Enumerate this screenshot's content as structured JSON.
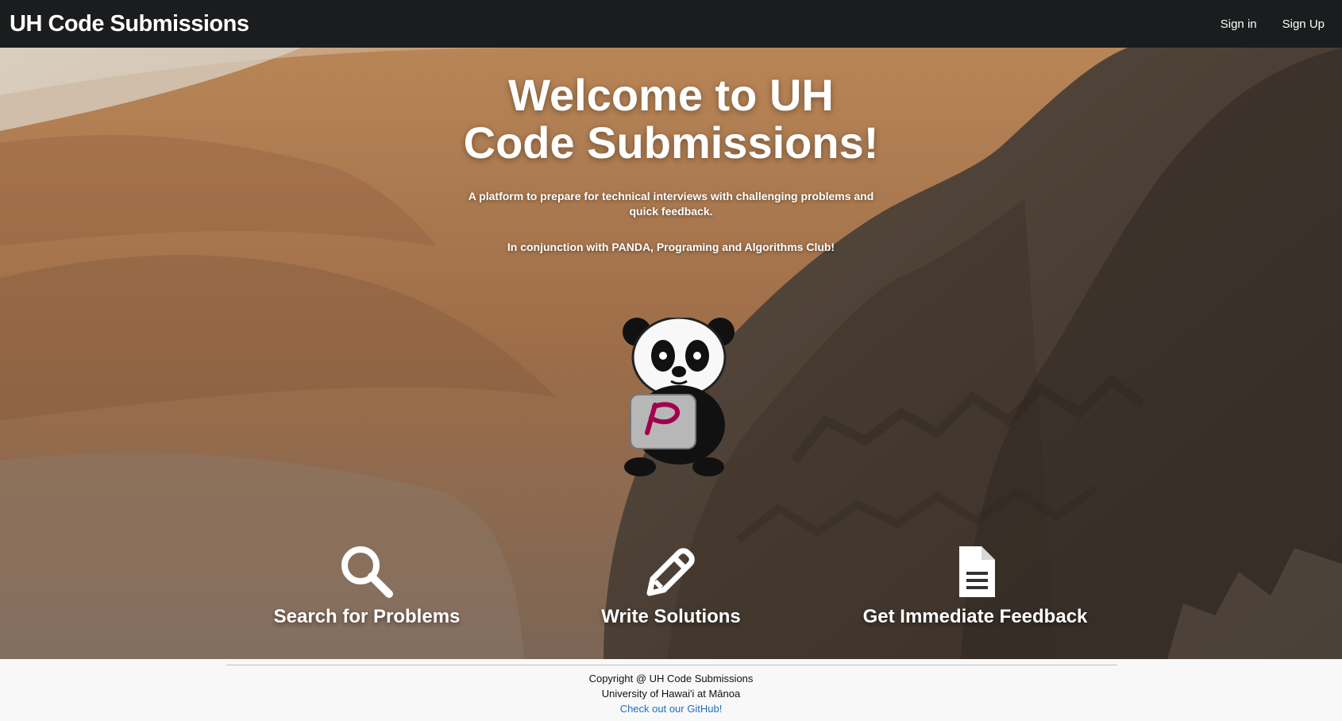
{
  "header": {
    "brand": "UH Code Submissions",
    "nav": {
      "sign_in": "Sign in",
      "sign_up": "Sign Up"
    }
  },
  "hero": {
    "title_line1": "Welcome to UH",
    "title_line2": "Code Submissions!",
    "subtitle_line1": "A platform to prepare for technical interviews with challenging problems and",
    "subtitle_line2": "quick feedback.",
    "club_text": "In conjunction with PANDA, Programing and Algorithms Club!",
    "mascot_icon": "panda-laptop-icon",
    "features": [
      {
        "icon": "search-icon",
        "label": "Search for Problems"
      },
      {
        "icon": "pencil-icon",
        "label": "Write Solutions"
      },
      {
        "icon": "document-icon",
        "label": "Get Immediate Feedback"
      }
    ]
  },
  "footer": {
    "copyright": "Copyright @ UH Code Submissions",
    "university": "University of Hawai'i at Mānoa",
    "github_link": "Check out our GitHub!"
  },
  "colors": {
    "navbar": "#1b1c1d",
    "footer_bg": "#f8f8f9",
    "link": "#1e70bf"
  }
}
